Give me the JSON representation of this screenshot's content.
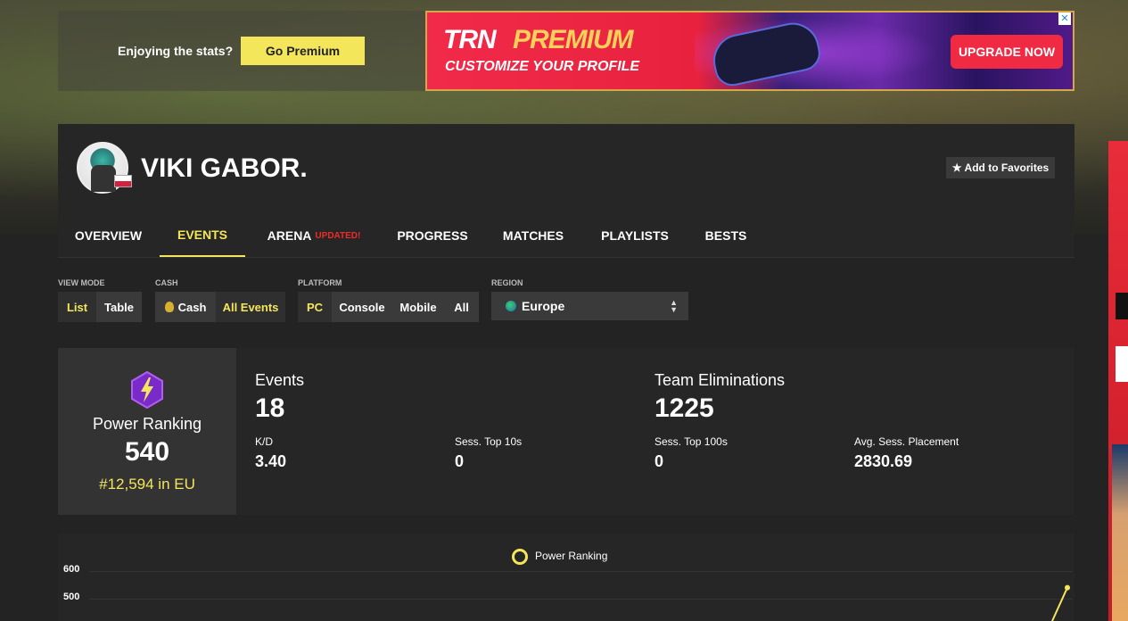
{
  "premium_bar": {
    "prompt_text": "Enjoying the stats?",
    "button_label": "Go Premium"
  },
  "ad_banner": {
    "brand": "TRN",
    "premium": "PREMIUM",
    "tagline": "CUSTOMIZE YOUR PROFILE",
    "cta": "UPGRADE NOW",
    "close": "✕"
  },
  "profile": {
    "name": "VIKI GABOR.",
    "favorite_label": "Add to Favorites",
    "favorite_icon": "★"
  },
  "tabs": [
    {
      "label": "OVERVIEW",
      "active": false
    },
    {
      "label": "EVENTS",
      "active": true
    },
    {
      "label": "ARENA",
      "badge": "UPDATED!",
      "active": false
    },
    {
      "label": "PROGRESS",
      "active": false
    },
    {
      "label": "MATCHES",
      "active": false
    },
    {
      "label": "PLAYLISTS",
      "active": false
    },
    {
      "label": "BESTS",
      "active": false
    }
  ],
  "filters": {
    "view_mode": {
      "label": "VIEW MODE",
      "options": [
        "List",
        "Table"
      ],
      "selected": "List"
    },
    "cash": {
      "label": "CASH",
      "options": [
        "Cash",
        "All Events"
      ],
      "selected": "All Events"
    },
    "platform": {
      "label": "PLATFORM",
      "options": [
        "PC",
        "Console",
        "Mobile",
        "All"
      ],
      "selected": "PC"
    },
    "region": {
      "label": "REGION",
      "value": "Europe"
    }
  },
  "power_ranking": {
    "title": "Power Ranking",
    "value": "540",
    "rank": "#12,594 in EU"
  },
  "stats": {
    "events": {
      "label": "Events",
      "value": "18"
    },
    "team_elims": {
      "label": "Team Eliminations",
      "value": "1225"
    },
    "kd": {
      "label": "K/D",
      "value": "3.40"
    },
    "sess_top10": {
      "label": "Sess. Top 10s",
      "value": "0"
    },
    "sess_top100": {
      "label": "Sess. Top 100s",
      "value": "0"
    },
    "avg_placement": {
      "label": "Avg. Sess. Placement",
      "value": "2830.69"
    }
  },
  "chart_data": {
    "type": "line",
    "series": [
      {
        "name": "Power Ranking",
        "values": [
          540
        ]
      }
    ],
    "yticks": [
      "600",
      "500"
    ],
    "ylim": [
      500,
      600
    ],
    "grid": true,
    "legend": "top-center",
    "color": "#f4e65b"
  },
  "colors": {
    "accent": "#f4e65b",
    "ad_red": "#f12a44",
    "updated_red": "#f12a2a"
  }
}
